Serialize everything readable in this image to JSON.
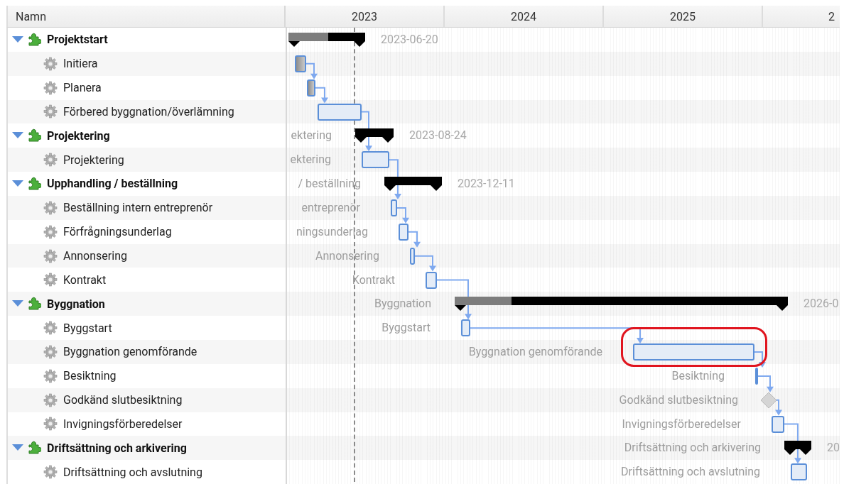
{
  "columns": {
    "name": "Namn"
  },
  "timeline": {
    "years": [
      "2023",
      "2024",
      "2025",
      "2"
    ]
  },
  "groups": [
    {
      "kind": "group",
      "name": "Projektstart",
      "expanded": true,
      "level": 0.52,
      "date_label": "2023-06-20",
      "children": [
        {
          "kind": "task",
          "name": "Initiera",
          "completed": true
        },
        {
          "kind": "task",
          "name": "Planera",
          "completed": true
        },
        {
          "kind": "task",
          "name": "Förbered byggnation/överlämning",
          "completed": false
        }
      ]
    },
    {
      "kind": "group",
      "name": "Projektering",
      "expanded": true,
      "bar_label": "ektering",
      "date_label": "2023-08-24",
      "children": [
        {
          "kind": "task",
          "name": "Projektering",
          "completed": false,
          "bar_label": "ektering"
        }
      ]
    },
    {
      "kind": "group",
      "name": "Upphandling / beställning",
      "expanded": true,
      "bar_label": "/ beställning",
      "date_label": "2023-12-11",
      "children": [
        {
          "kind": "task",
          "name": "Beställning intern entreprenör",
          "completed": false,
          "bar_label": "entreprenör"
        },
        {
          "kind": "task",
          "name": "Förfrågningsunderlag",
          "completed": false,
          "bar_label": "ningsunderlag"
        },
        {
          "kind": "task",
          "name": "Annonsering",
          "completed": false,
          "bar_label": "Annonsering"
        },
        {
          "kind": "task",
          "name": "Kontrakt",
          "completed": false,
          "bar_label": "Kontrakt"
        }
      ]
    },
    {
      "kind": "group",
      "name": "Byggnation",
      "expanded": true,
      "level": 0.17,
      "bar_label": "Byggnation",
      "date_label": "2026-0",
      "children": [
        {
          "kind": "task",
          "name": "Byggstart",
          "completed": false,
          "bar_label": "Byggstart"
        },
        {
          "kind": "task",
          "name": "Byggnation genomförande",
          "completed": false,
          "bar_label": "Byggnation genomförande"
        },
        {
          "kind": "task",
          "name": "Besiktning",
          "completed": false,
          "bar_label": "Besiktning"
        },
        {
          "kind": "milestone",
          "name": "Godkänd slutbesiktning",
          "bar_label": "Godkänd slutbesiktning"
        },
        {
          "kind": "task",
          "name": "Invigningsförberedelser",
          "completed": false,
          "bar_label": "Invigningsförberedelser"
        }
      ]
    },
    {
      "kind": "group",
      "name": "Driftsättning och arkivering",
      "expanded": true,
      "bar_label": "Driftsättning och arkivering",
      "date_label": "20",
      "children": [
        {
          "kind": "task",
          "name": "Driftsättning och avslutning",
          "completed": false,
          "bar_label": "Driftsättning och avslutning"
        }
      ]
    }
  ]
}
